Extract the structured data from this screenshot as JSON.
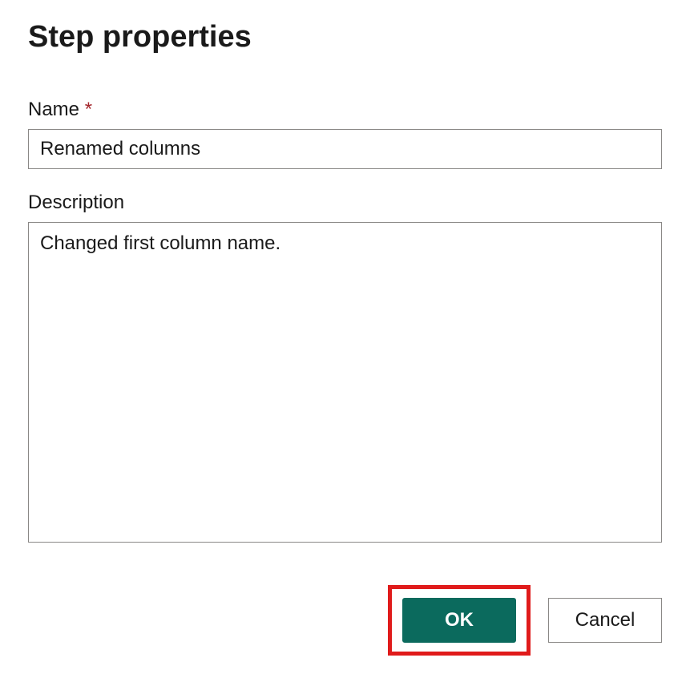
{
  "dialog": {
    "title": "Step properties",
    "fields": {
      "name": {
        "label": "Name",
        "required_mark": "*",
        "value": "Renamed columns"
      },
      "description": {
        "label": "Description",
        "value": "Changed first column name."
      }
    },
    "buttons": {
      "ok": "OK",
      "cancel": "Cancel"
    }
  }
}
